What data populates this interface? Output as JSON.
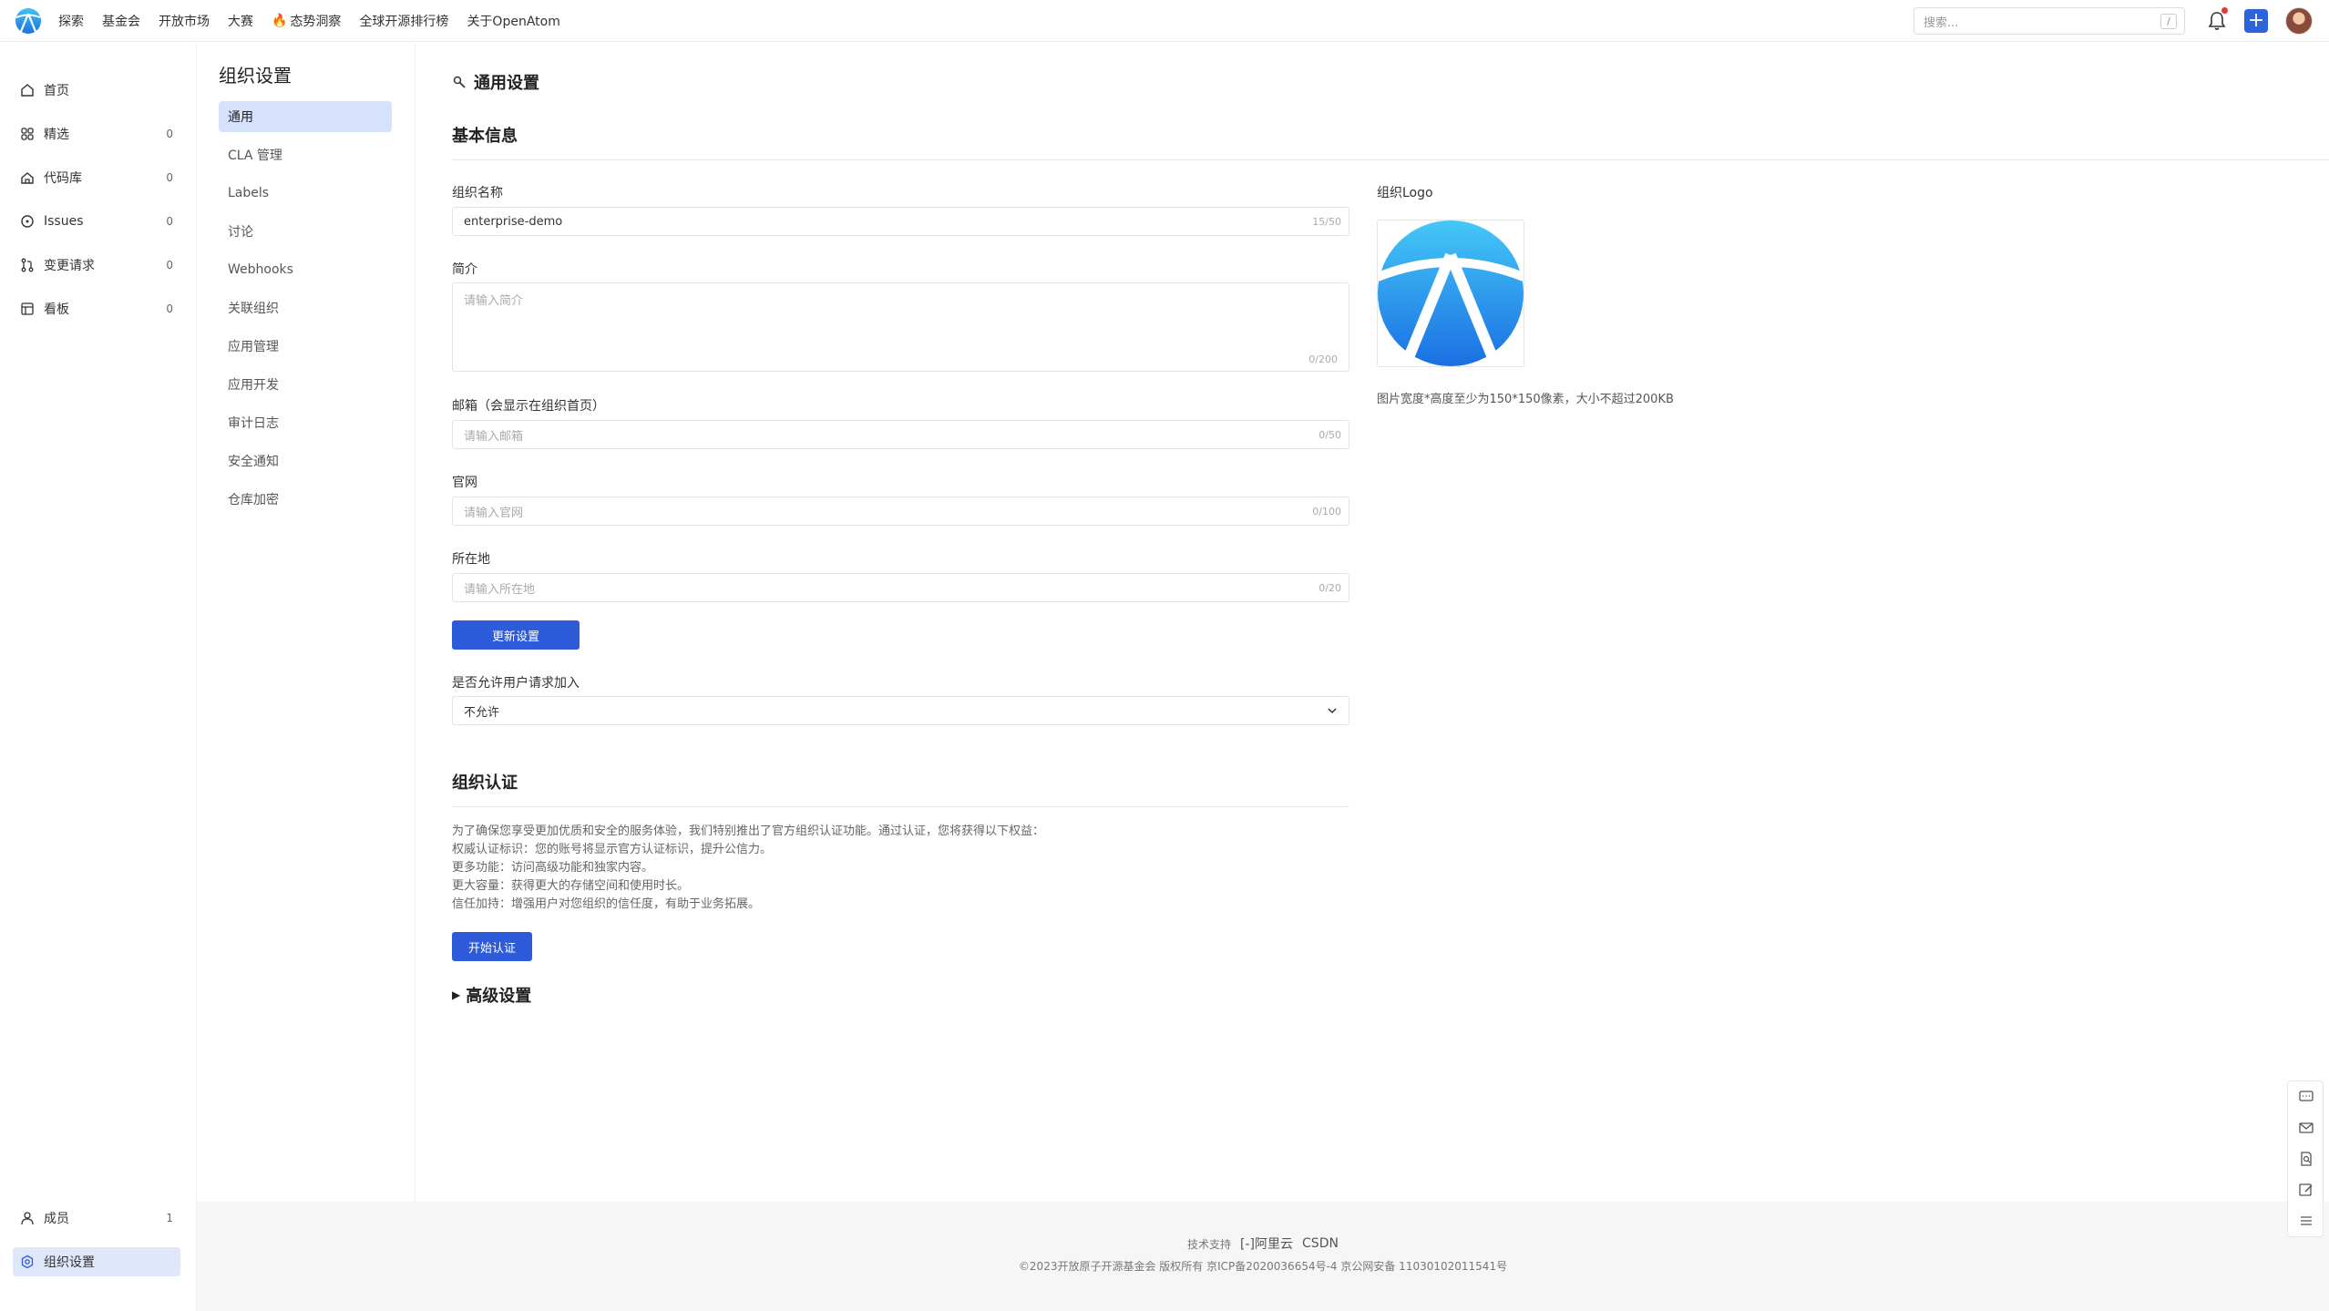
{
  "topnav": {
    "items": [
      "探索",
      "基金会",
      "开放市场",
      "大赛",
      "态势洞察",
      "全球开源排行榜",
      "关于OpenAtom"
    ],
    "search_placeholder": "搜索...",
    "search_shortcut": "/"
  },
  "sidebar": {
    "items": [
      {
        "label": "首页",
        "count": "",
        "icon": "home-icon"
      },
      {
        "label": "精选",
        "count": "0",
        "icon": "grid-icon"
      },
      {
        "label": "代码库",
        "count": "0",
        "icon": "repo-icon"
      },
      {
        "label": "Issues",
        "count": "0",
        "icon": "issue-icon"
      },
      {
        "label": "变更请求",
        "count": "0",
        "icon": "pull-request-icon"
      },
      {
        "label": "看板",
        "count": "0",
        "icon": "board-icon"
      }
    ],
    "bottom": [
      {
        "label": "成员",
        "count": "1",
        "icon": "user-icon"
      },
      {
        "label": "组织设置",
        "count": "",
        "icon": "settings-icon"
      }
    ]
  },
  "settings_nav": {
    "title": "组织设置",
    "items": [
      "通用",
      "CLA 管理",
      "Labels",
      "讨论",
      "Webhooks",
      "关联组织",
      "应用管理",
      "应用开发",
      "审计日志",
      "安全通知",
      "仓库加密"
    ]
  },
  "main": {
    "title": "通用设置",
    "basic_info_title": "基本信息",
    "name_label": "组织名称",
    "name_value": "enterprise-demo",
    "name_counter": "15/50",
    "intro_label": "简介",
    "intro_placeholder": "请输入简介",
    "intro_counter": "0/200",
    "email_label": "邮箱（会显示在组织首页）",
    "email_placeholder": "请输入邮箱",
    "email_counter": "0/50",
    "website_label": "官网",
    "website_placeholder": "请输入官网",
    "website_counter": "0/100",
    "location_label": "所在地",
    "location_placeholder": "请输入所在地",
    "location_counter": "0/20",
    "update_button": "更新设置",
    "join_label": "是否允许用户请求加入",
    "join_value": "不允许",
    "logo_label": "组织Logo",
    "logo_hint": "图片宽度*高度至少为150*150像素，大小不超过200KB",
    "cert_title": "组织认证",
    "cert_lines": [
      "为了确保您享受更加优质和安全的服务体验，我们特别推出了官方组织认证功能。通过认证，您将获得以下权益：",
      "权威认证标识：您的账号将显示官方认证标识，提升公信力。",
      "更多功能：访问高级功能和独家内容。",
      "更大容量：获得更大的存储空间和使用时长。",
      "信任加持：增强用户对您组织的信任度，有助于业务拓展。"
    ],
    "cert_button": "开始认证",
    "advanced_title": "高级设置"
  },
  "footer": {
    "tech_support": "技术支持",
    "aliyun": "阿里云",
    "csdn": "CSDN",
    "copyright": "©2023开放原子开源基金会 版权所有  京ICP备2020036654号-4  京公网安备 11030102011541号"
  },
  "colors": {
    "primary": "#2e5bd9",
    "active_bg": "#d6e2fb"
  }
}
